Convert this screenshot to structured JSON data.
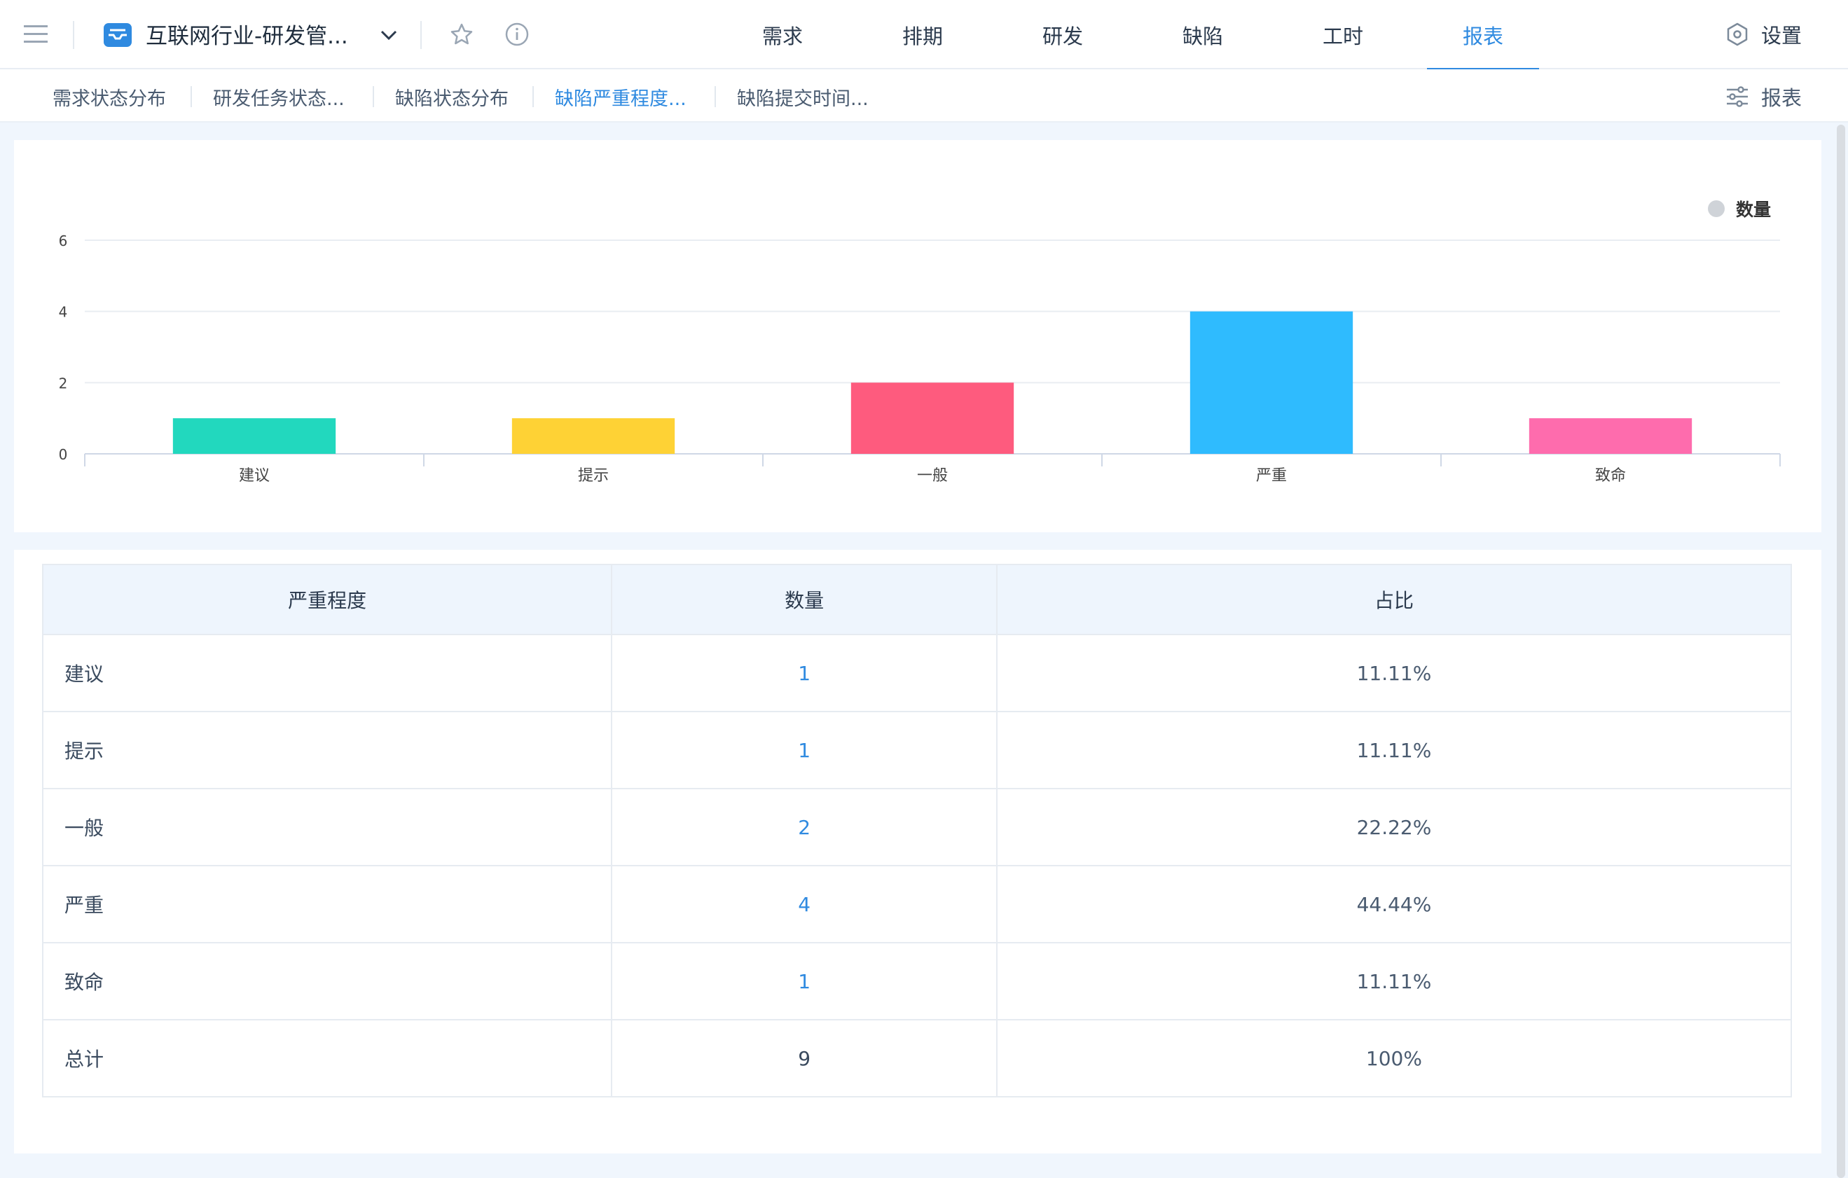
{
  "header": {
    "project_name": "互联网行业-研发管...",
    "nav_tabs": [
      {
        "label": "需求"
      },
      {
        "label": "排期"
      },
      {
        "label": "研发"
      },
      {
        "label": "缺陷"
      },
      {
        "label": "工时"
      },
      {
        "label": "报表"
      }
    ],
    "active_tab": "报表",
    "settings_label": "设置"
  },
  "subnav": {
    "tabs": [
      {
        "label": "需求状态分布"
      },
      {
        "label": "研发任务状态..."
      },
      {
        "label": "缺陷状态分布"
      },
      {
        "label": "缺陷严重程度..."
      },
      {
        "label": "缺陷提交时间..."
      }
    ],
    "active_tab": "缺陷严重程度...",
    "report_label": "报表"
  },
  "chart_data": {
    "type": "bar",
    "categories": [
      "建议",
      "提示",
      "一般",
      "严重",
      "致命"
    ],
    "series": [
      {
        "name": "数量",
        "values": [
          1,
          1,
          2,
          4,
          1
        ]
      }
    ],
    "colors": [
      "#22d8be",
      "#fed235",
      "#fe5b7e",
      "#2fbbfe",
      "#fe6cad"
    ],
    "yticks": [
      0,
      2,
      4,
      6
    ],
    "ylim": [
      0,
      6
    ],
    "legend_position": "top-right",
    "grid": true
  },
  "table": {
    "headers": [
      "严重程度",
      "数量",
      "占比"
    ],
    "rows": [
      {
        "level": "建议",
        "count": "1",
        "ratio": "11.11%"
      },
      {
        "level": "提示",
        "count": "1",
        "ratio": "11.11%"
      },
      {
        "level": "一般",
        "count": "2",
        "ratio": "22.22%"
      },
      {
        "level": "严重",
        "count": "4",
        "ratio": "44.44%"
      },
      {
        "level": "致命",
        "count": "1",
        "ratio": "11.11%"
      }
    ],
    "total": {
      "level": "总计",
      "count": "9",
      "ratio": "100%"
    }
  },
  "colors": {
    "accent": "#2f8ae0",
    "legend_dot": "#cfd3d8"
  }
}
